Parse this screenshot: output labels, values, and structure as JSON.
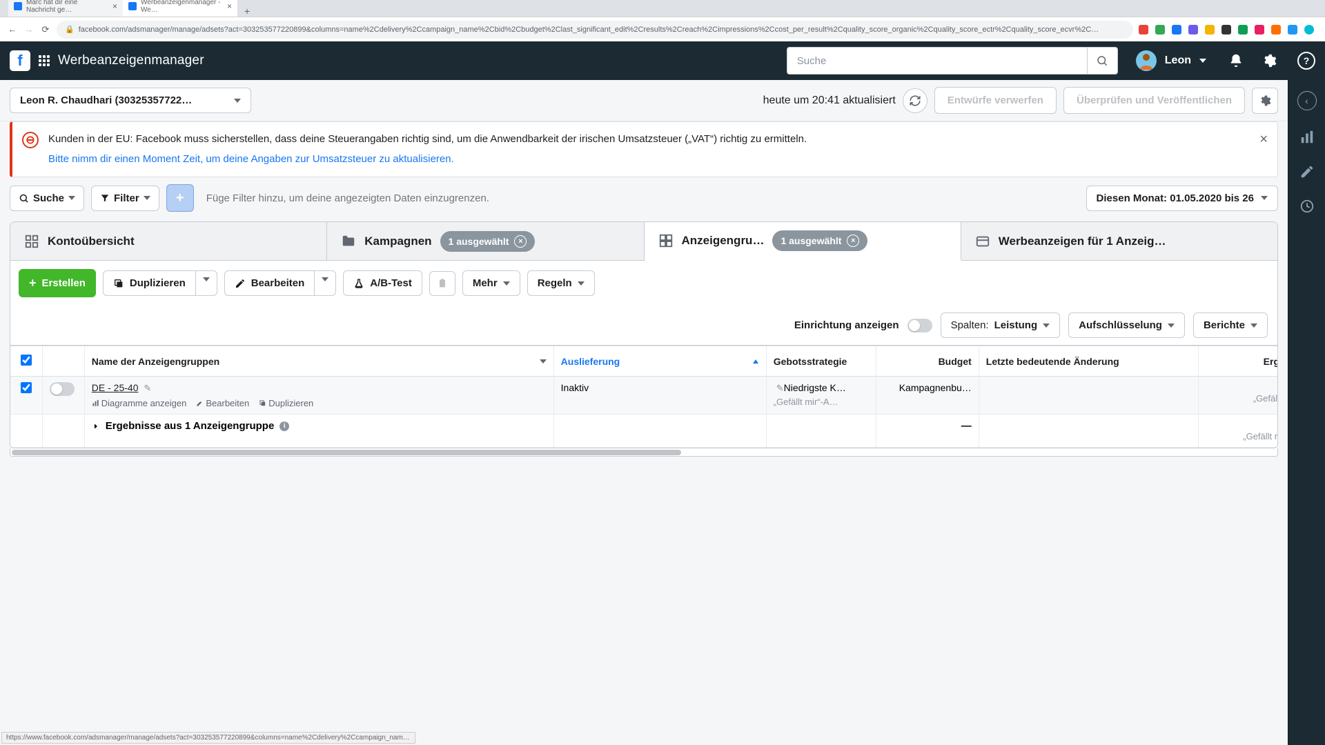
{
  "browser": {
    "tabs": [
      {
        "title": "Marc hat dir eine Nachricht ge…",
        "active": false
      },
      {
        "title": "Werbeanzeigenmanager - We…",
        "active": true
      }
    ],
    "url": "facebook.com/adsmanager/manage/adsets?act=303253577220899&columns=name%2Cdelivery%2Ccampaign_name%2Cbid%2Cbudget%2Clast_significant_edit%2Cresults%2Creach%2Cimpressions%2Ccost_per_result%2Cquality_score_organic%2Cquality_score_ectr%2Cquality_score_ecvr%2C…",
    "status_url": "https://www.facebook.com/adsmanager/manage/adsets?act=303253577220899&columns=name%2Cdelivery%2Ccampaign_name%2Cbid%2Cbu…"
  },
  "header": {
    "brand": "Werbeanzeigenmanager",
    "search_placeholder": "Suche",
    "user_name": "Leon"
  },
  "account_bar": {
    "account_name": "Leon R. Chaudhari (30325357722…",
    "updated_text": "heute um 20:41 aktualisiert",
    "discard_btn": "Entwürfe verwerfen",
    "review_btn": "Überprüfen und Veröffentlichen"
  },
  "alert": {
    "line1": "Kunden in der EU: Facebook muss sicherstellen, dass deine Steuerangaben richtig sind, um die Anwendbarkeit der irischen Umsatzsteuer („VAT“) richtig zu ermitteln.",
    "link_text": "Bitte nimm dir einen Moment Zeit, um deine Angaben zur Umsatzsteuer zu aktualisieren."
  },
  "filter_bar": {
    "search_label": "Suche",
    "filter_label": "Filter",
    "input_placeholder": "Füge Filter hinzu, um deine angezeigten Daten einzugrenzen.",
    "date_label": "Diesen Monat: 01.05.2020 bis 26"
  },
  "tabs": {
    "overview": "Kontoübersicht",
    "campaigns": "Kampagnen",
    "campaigns_chip": "1 ausgewählt",
    "adsets": "Anzeigengru…",
    "adsets_chip": "1 ausgewählt",
    "ads": "Werbeanzeigen für 1 Anzeig…"
  },
  "toolbar": {
    "create": "Erstellen",
    "duplicate": "Duplizieren",
    "edit": "Bearbeiten",
    "abtest": "A/B-Test",
    "more": "Mehr",
    "rules": "Regeln"
  },
  "sub_toolbar": {
    "setup_label": "Einrichtung anzeigen",
    "columns_prefix": "Spalten:",
    "columns_value": "Leistung",
    "breakdown": "Aufschlüsselung",
    "reports": "Berichte"
  },
  "columns": {
    "name": "Name der Anzeigengruppen",
    "delivery": "Auslieferung",
    "bidstrategy": "Gebotsstrategie",
    "budget": "Budget",
    "lastchange": "Letzte bedeutende Änderung",
    "results": "Erg"
  },
  "rows": [
    {
      "name": "DE - 25-40",
      "delivery": "Inaktiv",
      "bidstrategy_line1": "Niedrigste K…",
      "bidstrategy_line2": "„Gefällt mir“-A…",
      "budget": "Kampagnenbu…",
      "last_change": "",
      "results_line2": "„Gefäll"
    }
  ],
  "row_actions": {
    "charts": "Diagramme anzeigen",
    "edit": "Bearbeiten",
    "duplicate": "Duplizieren"
  },
  "summary": {
    "label": "Ergebnisse aus 1 Anzeigengruppe",
    "budget": "—",
    "results_line2": "„Gefällt n"
  }
}
